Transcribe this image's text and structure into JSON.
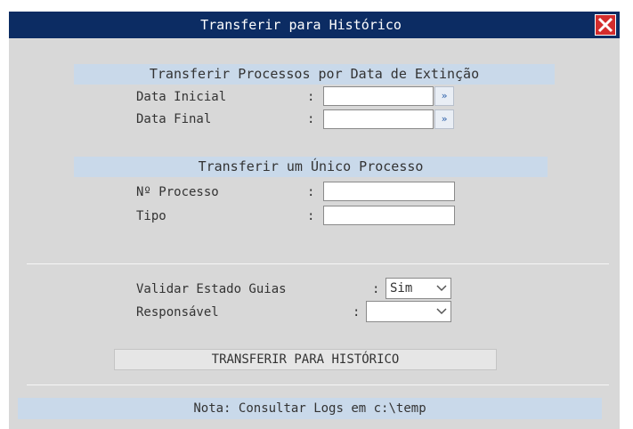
{
  "window": {
    "title": "Transferir para Histórico"
  },
  "section_date": {
    "header": "Transferir Processos por Data de Extinção",
    "start_label": "Data Inicial",
    "end_label": "Data Final",
    "colon": ":",
    "start_value": "",
    "end_value": "",
    "picker_glyph": "»"
  },
  "section_single": {
    "header": "Transferir um Único Processo",
    "number_label": "Nº Processo",
    "type_label": "Tipo",
    "colon": ":",
    "number_value": "",
    "type_value": ""
  },
  "options": {
    "validate_label": "Validar Estado Guias",
    "validate_value": "Sim",
    "responsible_label": "Responsável",
    "responsible_value": "",
    "colon": ":"
  },
  "actions": {
    "transfer_label": "TRANSFERIR PARA HISTÓRICO"
  },
  "footer": {
    "note": "Nota: Consultar Logs em c:\\temp"
  },
  "colors": {
    "titlebar": "#0c2c63",
    "panel": "#d8d8d8",
    "section_header": "#c9d9ea",
    "close": "#d42d2d"
  },
  "icons": {
    "close": "close-x-icon",
    "date_picker": "double-chevron-right-icon",
    "dropdown": "chevron-down-icon"
  }
}
